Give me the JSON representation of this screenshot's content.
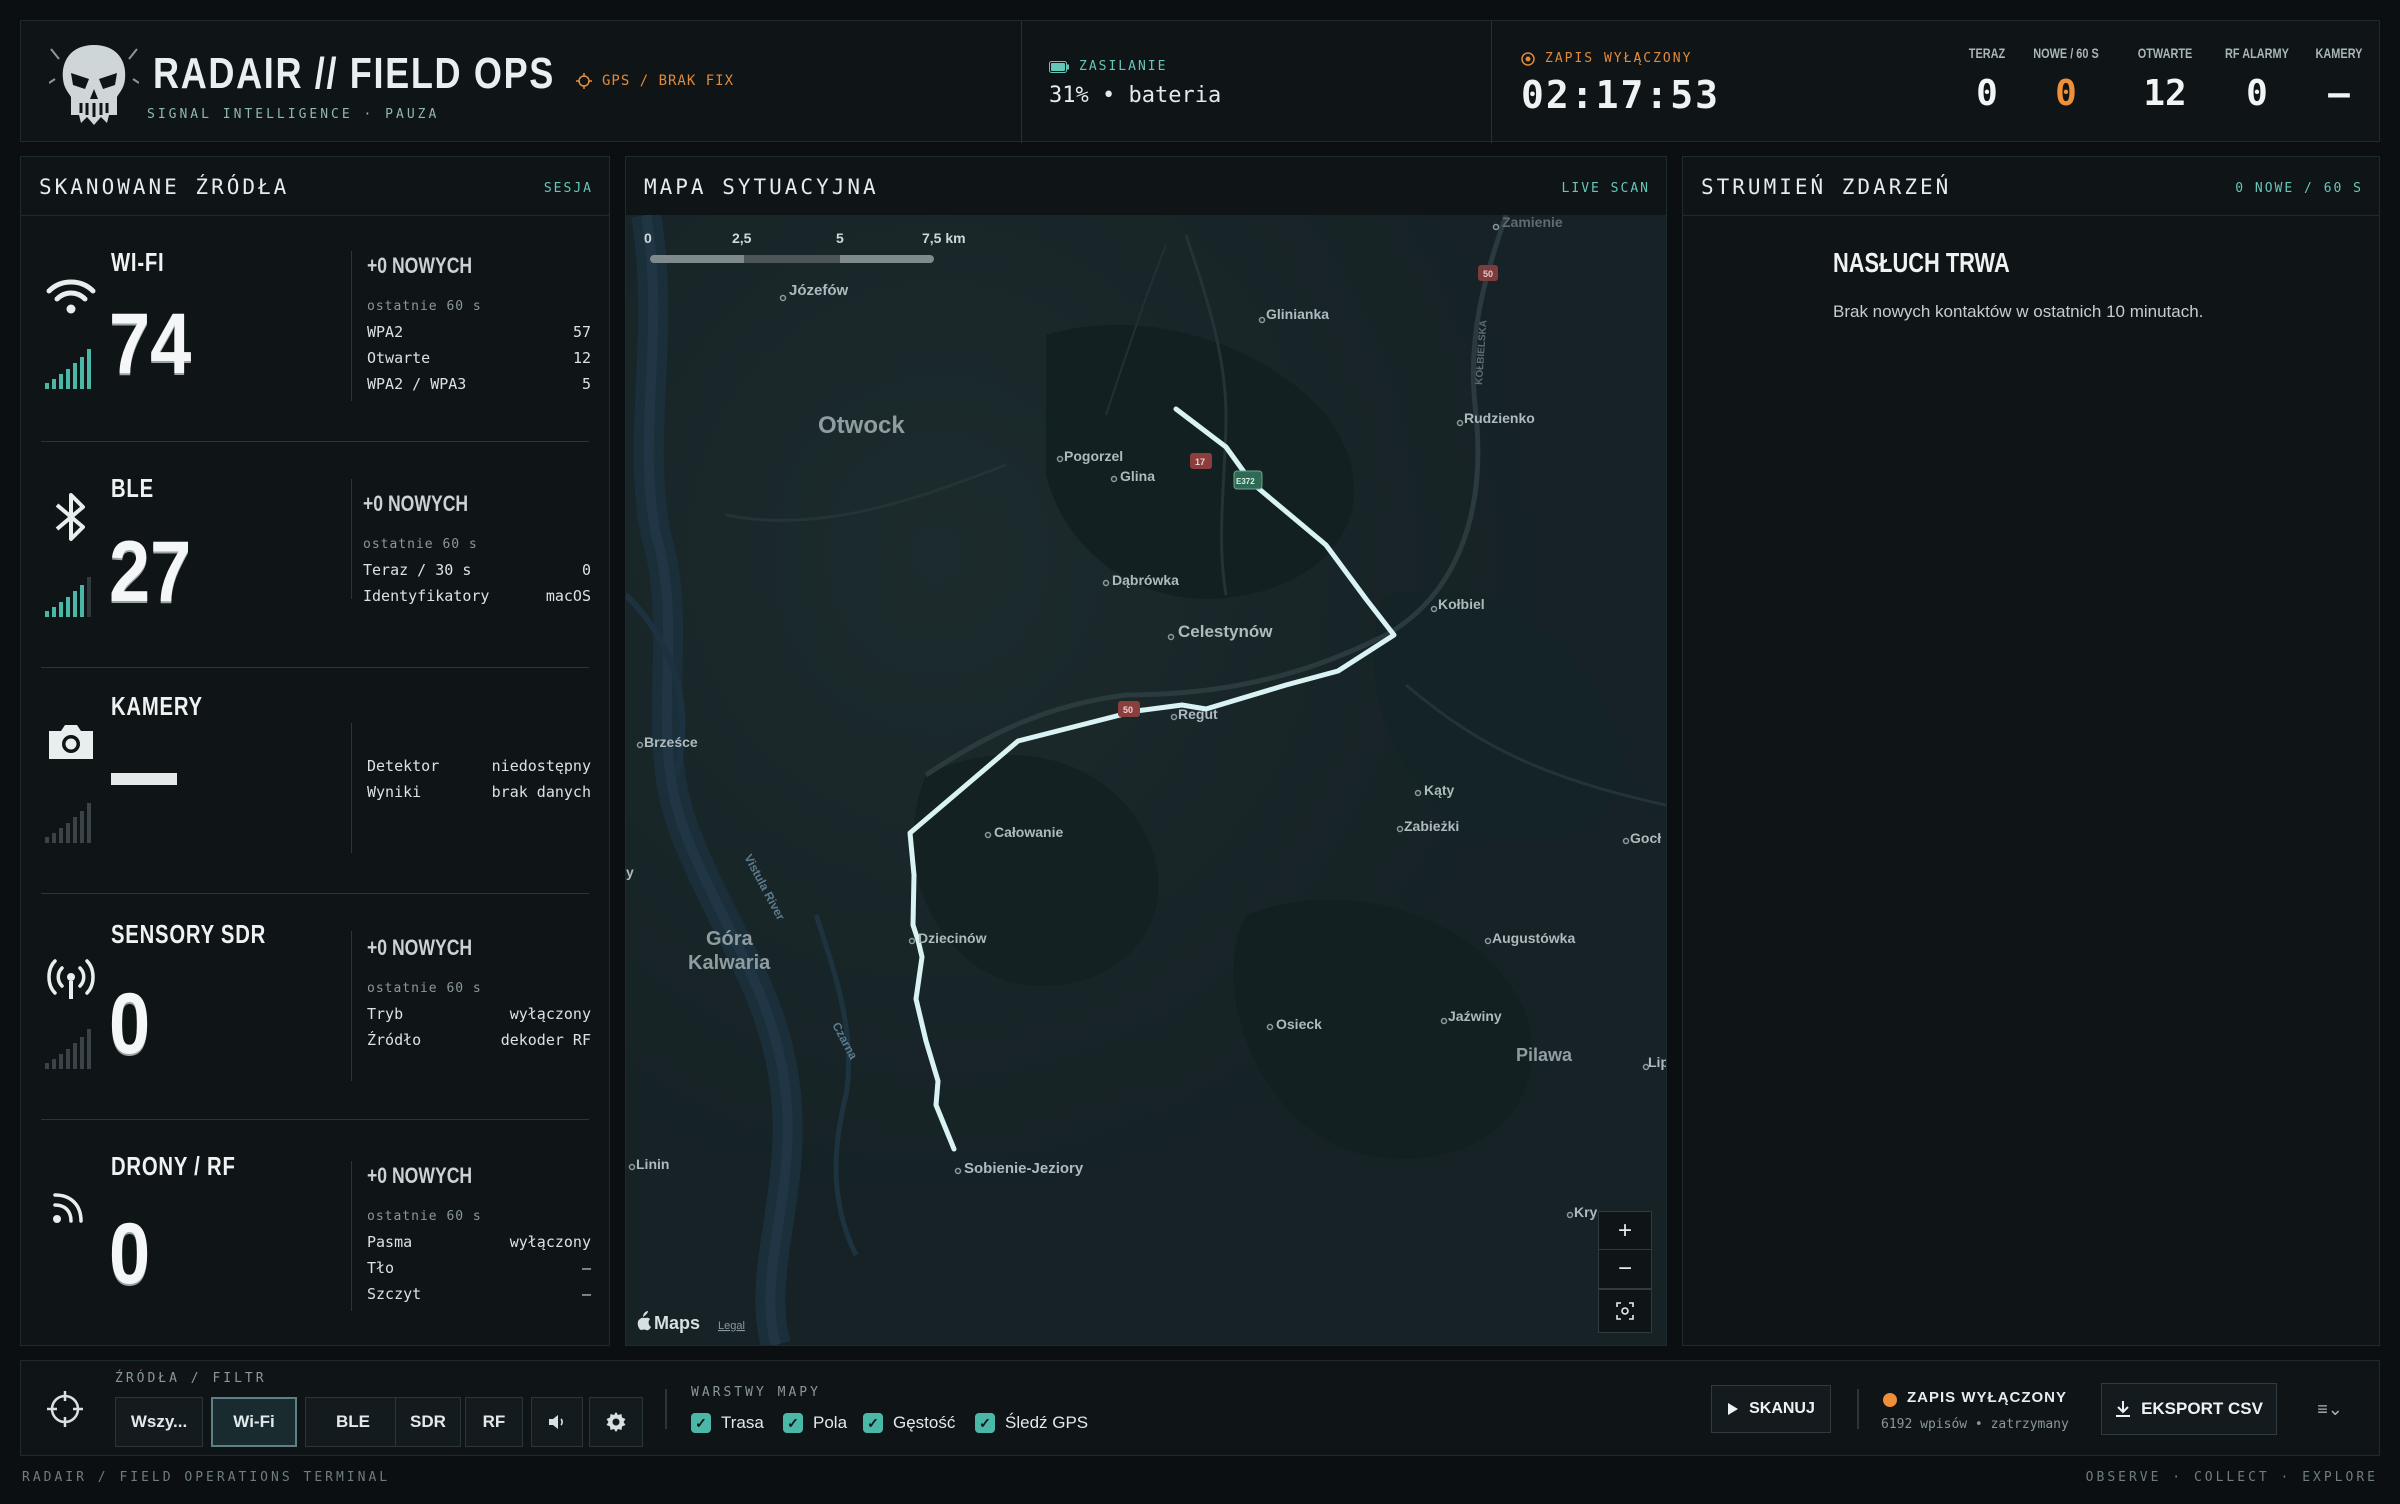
{
  "header": {
    "title": "RADAIR // FIELD OPS",
    "subtitle": "SIGNAL INTELLIGENCE · PAUZA",
    "gps_status": "GPS / BRAK FIX",
    "power_label": "ZASILANIE",
    "power_value": "31% • bateria",
    "rec_label": "ZAPIS WYŁĄCZONY",
    "clock": "02:17:53",
    "stats": [
      {
        "label": "TERAZ",
        "value": "0"
      },
      {
        "label": "NOWE / 60 S",
        "value": "0"
      },
      {
        "label": "OTWARTE",
        "value": "12"
      },
      {
        "label": "RF ALARMY",
        "value": "0"
      },
      {
        "label": "KAMERY",
        "value": "—"
      }
    ]
  },
  "sources": {
    "title": "SKANOWANE ŹRÓDŁA",
    "tag": "SESJA",
    "wifi": {
      "name": "WI-FI",
      "count": "74",
      "new": "+0 NOWYCH",
      "window": "ostatnie 60 s",
      "rows": [
        {
          "k": "WPA2",
          "v": "57"
        },
        {
          "k": "Otwarte",
          "v": "12"
        },
        {
          "k": "WPA2 / WPA3",
          "v": "5"
        }
      ]
    },
    "ble": {
      "name": "BLE",
      "count": "27",
      "new": "+0 NOWYCH",
      "window": "ostatnie 60 s",
      "rows": [
        {
          "k": "Teraz / 30 s",
          "v": "0"
        },
        {
          "k": "Identyfikatory",
          "v": "macOS"
        }
      ]
    },
    "cameras": {
      "name": "KAMERY",
      "rows": [
        {
          "k": "Detektor",
          "v": "niedostępny"
        },
        {
          "k": "Wyniki",
          "v": "brak danych"
        }
      ]
    },
    "sdr": {
      "name": "SENSORY SDR",
      "count": "0",
      "new": "+0 NOWYCH",
      "window": "ostatnie 60 s",
      "rows": [
        {
          "k": "Tryb",
          "v": "wyłączony"
        },
        {
          "k": "Źródło",
          "v": "dekoder RF"
        }
      ]
    },
    "drones": {
      "name": "DRONY / RF",
      "count": "0",
      "new": "+0 NOWYCH",
      "window": "ostatnie 60 s",
      "rows": [
        {
          "k": "Pasma",
          "v": "wyłączony"
        },
        {
          "k": "Tło",
          "v": "—"
        },
        {
          "k": "Szczyt",
          "v": "—"
        }
      ]
    }
  },
  "map": {
    "title": "MAPA SYTUACYJNA",
    "tag": "LIVE SCAN",
    "scale": [
      "0",
      "2,5",
      "5",
      "7,5 km"
    ],
    "attribution": "Maps",
    "legal": "Legal",
    "places": {
      "otwock": "Otwock",
      "jozefow": "Józefów",
      "glinianka": "Glinianka",
      "zamienie": "Zamienie",
      "rudzienko": "Rudzienko",
      "pogorzel": "Pogorzel",
      "glina": "Glina",
      "dabrowka": "Dąbrówka",
      "celestynow": "Celestynów",
      "kolbiel": "Kołbiel",
      "regut": "Regut",
      "brzesce": "Brześce",
      "calowanie": "Całowanie",
      "katy": "Kąty",
      "zabiezki": "Zabieżki",
      "gocl": "Gocł",
      "gora_kalwaria": "Góra\nKalwaria",
      "dziecinow": "Dziecinów",
      "augustowka": "Augustówka",
      "osieck": "Osieck",
      "jazwiny": "Jaźwiny",
      "pilawa": "Pilawa",
      "lip": "Lip",
      "linin": "Linin",
      "sobienie": "Sobienie-Jeziory",
      "kry": "Kry",
      "vistula": "Vistula River",
      "czarna": "Czarna",
      "kolbielska": "KOŁBIELSKA",
      "y": "y",
      "r50a": "50",
      "r50b": "50",
      "r17": "17",
      "e372": "E372"
    },
    "zoom_in": "+",
    "zoom_out": "−",
    "recenter": "recenter"
  },
  "events": {
    "title": "STRUMIEŃ ZDARZEŃ",
    "tag": "0 NOWE / 60 S",
    "status_title": "NASŁUCH TRWA",
    "status_msg": "Brak nowych kontaktów w ostatnich 10 minutach."
  },
  "bottombar": {
    "filter_label": "ŹRÓDŁA / FILTR",
    "filters": [
      "Wszy...",
      "Wi-Fi",
      "BLE",
      "SDR",
      "RF"
    ],
    "active_filter": "Wi-Fi",
    "layers_label": "WARSTWY MAPY",
    "layers": [
      "Trasa",
      "Pola",
      "Gęstość",
      "Śledź GPS"
    ],
    "scan": "SKANUJ",
    "rec_status": "ZAPIS WYŁĄCZONY",
    "rec_detail": "6192 wpisów • zatrzymany",
    "export": "EKSPORT CSV",
    "menu": "≡⌄"
  },
  "footer": {
    "left": "RADAIR / FIELD OPERATIONS TERMINAL",
    "right": "OBSERVE · COLLECT · EXPLORE"
  },
  "colors": {
    "accent_teal": "#66c6b8",
    "accent_orange": "#ef8f3a",
    "route": "#d9f3f4",
    "background": "#0b0f11"
  }
}
